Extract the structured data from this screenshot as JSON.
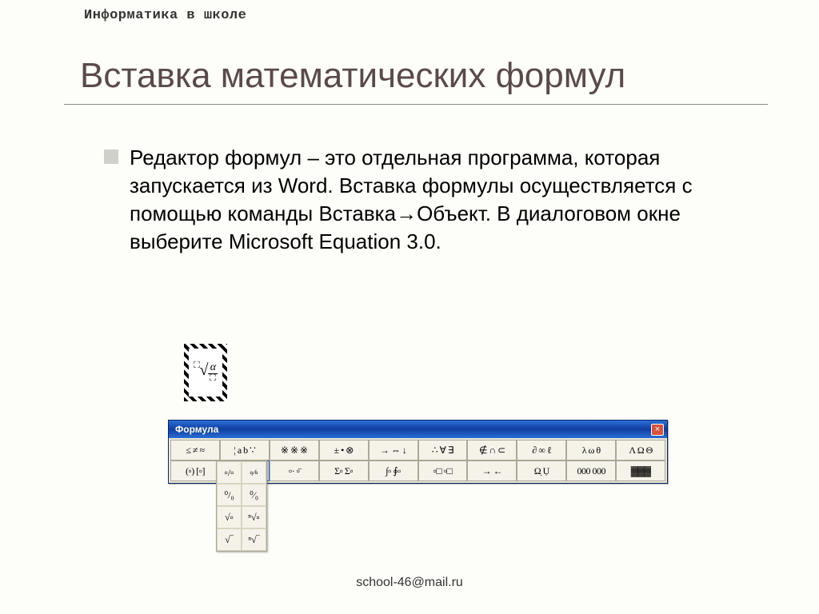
{
  "header": "Информатика в школе",
  "title": "Вставка математических формул",
  "body": "Редактор формул – это отдельная программа, которая запускается из Word. Вставка формулы осуществляется с помощью команды Вставка→Объект. В диалоговом окне выберите Microsoft Equation 3.0.",
  "equation_object": {
    "numerator": "α",
    "denominator_placeholder": true,
    "index_placeholder": true
  },
  "toolbar": {
    "title": "Формула",
    "close": "×",
    "rows": [
      [
        "≤ ≠ ≈",
        "¦ a b ∵",
        "※ ※ ※",
        "± • ⊗",
        "→ ⇔ ↓",
        "∴ ∀ ∃",
        "∉ ∩ ⊂",
        "∂ ∞ ℓ",
        "λ ω θ",
        "Λ Ω Θ"
      ],
      [
        "(▫) [▫]",
        "▫/▫ √▫",
        "▫· ▫̈",
        "Σ▫ Σ▫",
        "∫▫ ∮▫",
        "▫□ ▫□",
        "→ ←",
        "Ω̣ Ụ",
        "000\n000",
        "▓▓▓"
      ]
    ],
    "active_cell": {
      "row": 1,
      "col": 1
    }
  },
  "dropdown": {
    "items": [
      "▫/▫",
      "▫⁄▫",
      "⁰/₀",
      "⁰⁄₀",
      "√▫",
      "ⁿ√▫",
      "√‾",
      "ⁿ√‾"
    ]
  },
  "footer": "school-46@mail.ru"
}
